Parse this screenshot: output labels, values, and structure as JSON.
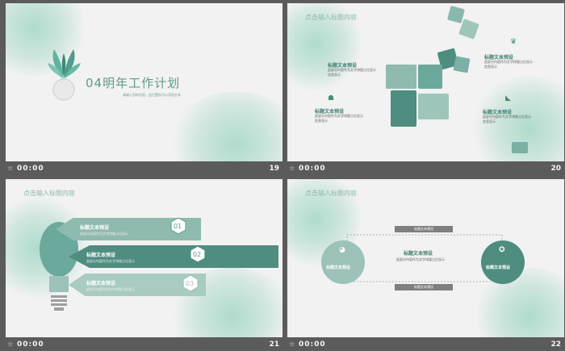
{
  "slides": [
    {
      "title": "04明年工作计划",
      "subtitle": "请输入您的内容，此位置你可以添加文本",
      "time": "00:00",
      "number": "19"
    },
    {
      "header": "点击输入标题内容",
      "items": [
        {
          "title": "标题文本预设",
          "desc": "此部分内容作为文字排版占位显示"
        },
        {
          "title": "标题文本预设",
          "desc": "此部分内容作为文字排版占位显示"
        },
        {
          "title": "标题文本预设",
          "desc": "此部分内容作为文字排版占位显示"
        },
        {
          "title": "标题文本预设",
          "desc": "此部分内容作为文字排版占位显示"
        }
      ],
      "desc_tail": "信息显示",
      "time": "00:00",
      "number": "20"
    },
    {
      "header": "点击输入标题内容",
      "items": [
        {
          "num": "01",
          "title": "标题文本预设",
          "desc": "此部分内容作为文字排版占位显示"
        },
        {
          "num": "02",
          "title": "标题文本预设",
          "desc": "此部分内容作为文字排版占位显示"
        },
        {
          "num": "03",
          "title": "标题文本预设",
          "desc": "此部分内容作为文字排版占位显示"
        }
      ],
      "time": "00:00",
      "number": "21"
    },
    {
      "header": "点击输入标题内容",
      "bar_label": "标题文本预设",
      "left_label": "标题文本预设",
      "right_label": "标题文本预设",
      "center_title": "标题文本预设",
      "center_desc": "此部分内容作为文字排版占位显示",
      "time": "00:00",
      "number": "22"
    }
  ],
  "colors": {
    "teal": "#6aa99b",
    "teal_dark": "#4e8d80",
    "grey": "#7f7f7f"
  }
}
